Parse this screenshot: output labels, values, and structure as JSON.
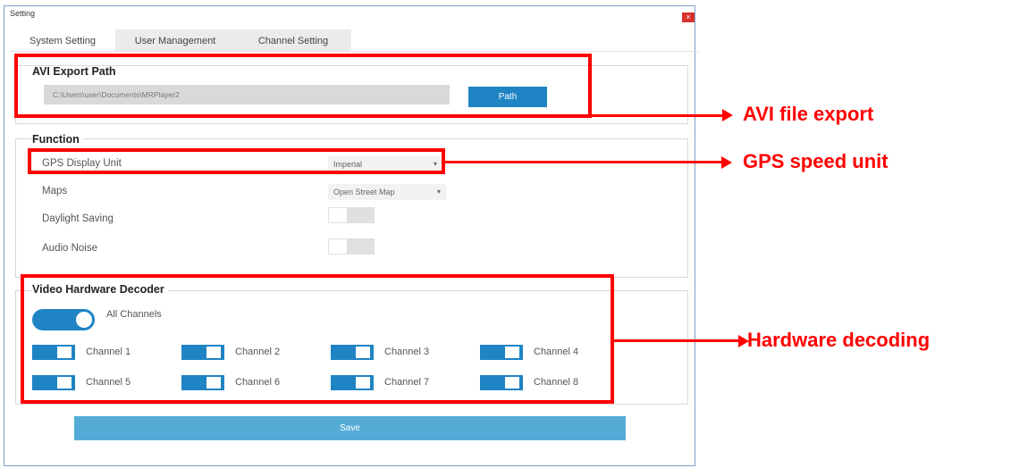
{
  "window": {
    "title": "Setting",
    "close_glyph": "×"
  },
  "tabs": [
    {
      "label": "System Setting"
    },
    {
      "label": "User Management"
    },
    {
      "label": "Channel Setting"
    }
  ],
  "avi_export": {
    "title": "AVI Export Path",
    "path_value": "C:\\Users\\user\\Documents\\MRPlayer2",
    "path_button": "Path"
  },
  "function": {
    "title": "Function",
    "gps_label": "GPS Display Unit",
    "gps_value": "Imperial",
    "maps_label": "Maps",
    "maps_value": "Open Street Map",
    "daylight_label": "Daylight Saving",
    "audio_label": "Audio Noise"
  },
  "decoder": {
    "title": "Video Hardware Decoder",
    "all_label": "All Channels",
    "channels": [
      "Channel 1",
      "Channel 2",
      "Channel 3",
      "Channel 4",
      "Channel 5",
      "Channel 6",
      "Channel 7",
      "Channel 8"
    ]
  },
  "save_label": "Save",
  "callouts": {
    "avi": "AVI file export",
    "gps": "GPS speed unit",
    "hw": "Hardware decoding"
  },
  "colors": {
    "accent": "#1e84c3",
    "save": "#54acd6",
    "annotation": "#ff0000",
    "close": "#d9322e"
  },
  "icons": {
    "dropdown": "chevron-down-icon",
    "close": "close-icon"
  }
}
